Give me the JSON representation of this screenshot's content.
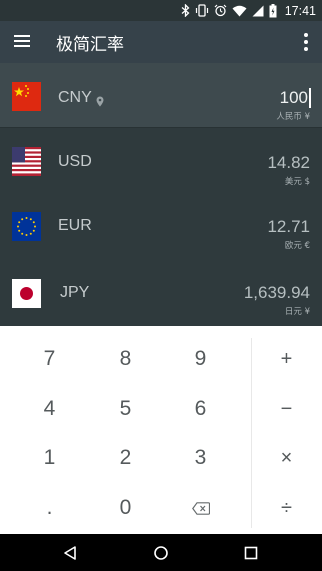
{
  "status_bar": {
    "time": "17:41",
    "icons": [
      "bluetooth-icon",
      "vibrate-icon",
      "alarm-icon",
      "wifi-icon",
      "signal-icon",
      "battery-icon"
    ]
  },
  "app_bar": {
    "title": "极简汇率",
    "menu_icon": "menu-icon",
    "overflow_icon": "more-vert-icon"
  },
  "currencies": [
    {
      "code": "CNY",
      "name": "人民币 ¥",
      "amount": "100",
      "flag": "china-flag",
      "active": true
    },
    {
      "code": "USD",
      "name": "美元 $",
      "amount": "14.82",
      "flag": "usa-flag",
      "active": false
    },
    {
      "code": "EUR",
      "name": "欧元 €",
      "amount": "12.71",
      "flag": "eu-flag",
      "active": false
    },
    {
      "code": "JPY",
      "name": "日元 ¥",
      "amount": "1,639.94",
      "flag": "japan-flag",
      "active": false
    }
  ],
  "keypad": {
    "digits": [
      "7",
      "8",
      "9",
      "4",
      "5",
      "6",
      "1",
      "2",
      "3",
      ".",
      "0"
    ],
    "ops": [
      "+",
      "−",
      "×",
      "÷"
    ],
    "backspace_icon": "backspace-icon"
  },
  "nav_bar": {
    "icons": [
      "back-icon",
      "home-icon",
      "recents-icon"
    ]
  },
  "colors": {
    "status_bar": "#2b3537",
    "app_bar": "#36424a",
    "list_bg": "#2f3a3d",
    "active_row": "#3e4a4e",
    "keypad_bg": "#ffffff",
    "key_text": "#555a5c"
  }
}
